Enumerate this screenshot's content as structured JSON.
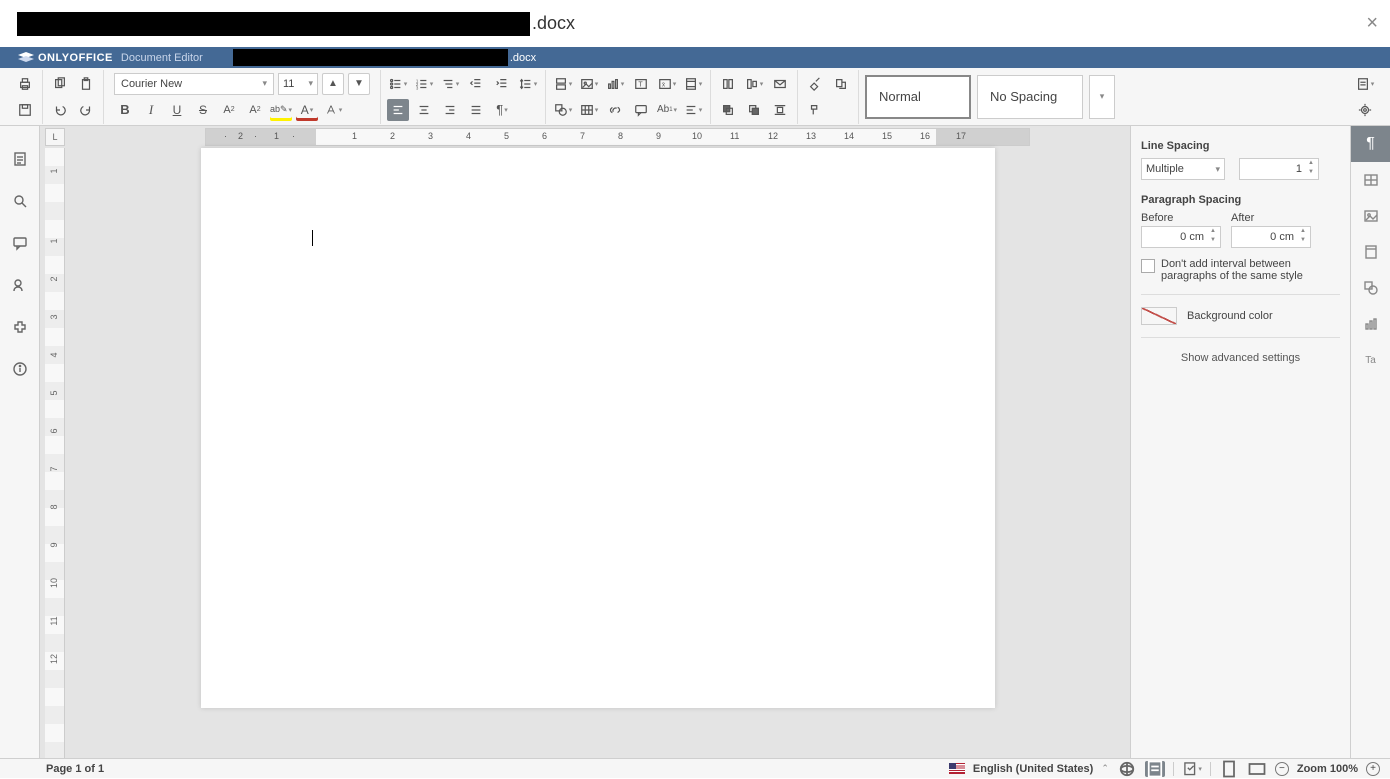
{
  "titlebar": {
    "extension": ".docx"
  },
  "appheader": {
    "brand": "ONLYOFFICE",
    "subtitle": "Document Editor",
    "file_ext": ".docx"
  },
  "toolbar": {
    "font_name": "Courier New",
    "font_size": "11",
    "styles": {
      "normal": "Normal",
      "no_spacing": "No Spacing"
    }
  },
  "ruler": {
    "corner": "L",
    "h_labels": [
      "2",
      "1",
      "1",
      "2",
      "3",
      "4",
      "5",
      "6",
      "7",
      "8",
      "9",
      "10",
      "11",
      "12",
      "13",
      "14",
      "15",
      "16",
      "17"
    ],
    "v_labels": [
      "1",
      "1",
      "2",
      "3",
      "4",
      "5",
      "6",
      "7",
      "8",
      "9",
      "10",
      "11",
      "12"
    ]
  },
  "rpanel": {
    "line_spacing_label": "Line Spacing",
    "line_spacing_type": "Multiple",
    "line_spacing_value": "1",
    "para_spacing_label": "Paragraph Spacing",
    "before_label": "Before",
    "after_label": "After",
    "before_value": "0 cm",
    "after_value": "0 cm",
    "chk_label": "Don't add interval between paragraphs of the same style",
    "bgcolor_label": "Background color",
    "advanced": "Show advanced settings"
  },
  "status": {
    "page": "Page 1 of 1",
    "lang": "English (United States)",
    "zoom": "Zoom 100%"
  }
}
